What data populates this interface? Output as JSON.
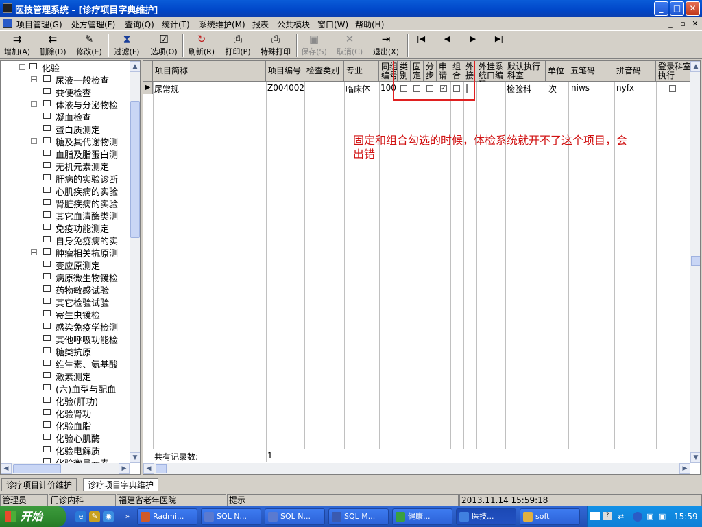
{
  "window": {
    "title": "医技管理系统 - [诊疗项目字典维护]",
    "min": "_",
    "max": "□",
    "close": "✕"
  },
  "menu": [
    "项目管理(G)",
    "处方管理(F)",
    "查询(Q)",
    "统计(T)",
    "系统维护(M)",
    "报表",
    "公共模块",
    "窗口(W)",
    "帮助(H)"
  ],
  "toolbar": {
    "add": "增加(A)",
    "delete": "删除(D)",
    "edit": "修改(E)",
    "filter": "过滤(F)",
    "options": "选项(O)",
    "refresh": "刷新(R)",
    "print": "打印(P)",
    "special_print": "特殊打印",
    "save": "保存(S)",
    "cancel": "取消(C)",
    "exit": "退出(X)"
  },
  "tree": {
    "root": "化验",
    "items": [
      "尿液一般检查",
      "粪便检查",
      "体液与分泌物检",
      "凝血检查",
      "蛋白质测定",
      "糖及其代谢物测",
      "血脂及脂蛋白测",
      "无机元素测定",
      "肝病的实验诊断",
      "心肌疾病的实验",
      "肾脏疾病的实验",
      "其它血清酶类测",
      "免疫功能测定",
      "自身免疫病的实",
      "肿瘤相关抗原测",
      "变应原测定",
      "病原微生物镜检",
      "药物敏感试验",
      "其它检验试验",
      "寄生虫镜检",
      "感染免疫学检测",
      "其他呼吸功能检",
      "糖类抗原",
      "维生素、氨基酸",
      "激素测定",
      "(六)血型与配血",
      "化验(肝功)",
      "化验肾功",
      "化验血脂",
      "化验心肌酶",
      "化验电解质",
      "化验微量元素"
    ]
  },
  "grid": {
    "headers": {
      "name": "项目简称",
      "code": "项目编号",
      "check_type": "检查类别",
      "major": "专业",
      "group_code": "同组编号",
      "category": "类别",
      "fixed": "固定",
      "step": "分步",
      "apply": "申请",
      "combo": "组合",
      "external": "外接",
      "ext_code": "外挂系统口编码",
      "dept": "默认执行科室",
      "unit": "单位",
      "wubi": "五笔码",
      "pinyin": "拼音码",
      "reg_exec": "登录科室执行"
    },
    "row": {
      "name": "尿常规",
      "code": "Z004002",
      "check_type": "",
      "major": "临床体",
      "group_code": "100",
      "category": false,
      "fixed": false,
      "step": false,
      "apply": true,
      "combo": false,
      "external": "|",
      "ext_code": "",
      "dept": "检验科",
      "unit": "次",
      "wubi": "niws",
      "pinyin": "nyfx",
      "reg_exec": false
    },
    "footer_label": "共有记录数:",
    "footer_count": "1"
  },
  "annotation": "固定和组合勾选的时候，体检系统就开不了这个项目，会出错",
  "tabs": [
    "诊疗项目计价维护",
    "诊疗项目字典维护"
  ],
  "status": {
    "user": "管理员",
    "dept": "门诊内科",
    "hospital": "福建省老年医院",
    "hint": "提示",
    "datetime": "2013.11.14 15:59:18"
  },
  "taskbar": {
    "start": "开始",
    "tasks": [
      "Radmi...",
      "SQL N...",
      "SQL N...",
      "SQL M...",
      "健康...",
      "医技...",
      "soft"
    ],
    "clock": "15:59"
  },
  "colors": {
    "titlebar": "#0046c8",
    "annotation": "#d01010",
    "taskbar": "#2a5cc6"
  }
}
